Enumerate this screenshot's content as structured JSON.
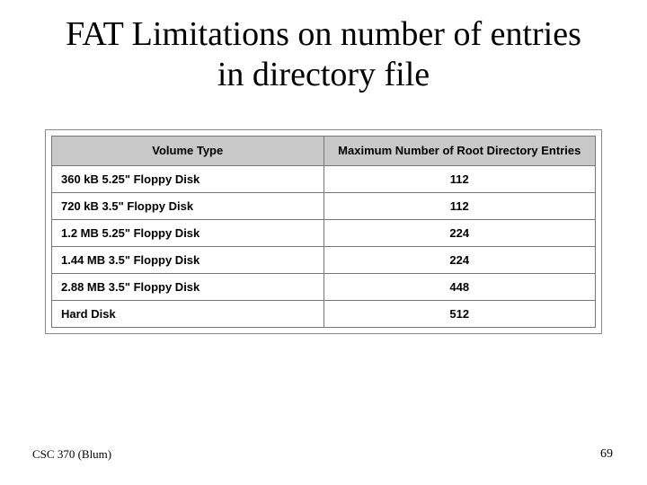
{
  "title": "FAT Limitations on number of entries in directory file",
  "chart_data": {
    "type": "table",
    "columns": [
      "Volume Type",
      "Maximum Number of Root Directory Entries"
    ],
    "rows": [
      {
        "volume": "360 kB 5.25\" Floppy Disk",
        "entries": "112"
      },
      {
        "volume": "720 kB 3.5\" Floppy Disk",
        "entries": "112"
      },
      {
        "volume": "1.2 MB 5.25\" Floppy Disk",
        "entries": "224"
      },
      {
        "volume": "1.44 MB 3.5\" Floppy Disk",
        "entries": "224"
      },
      {
        "volume": "2.88 MB 3.5\" Floppy Disk",
        "entries": "448"
      },
      {
        "volume": "Hard Disk",
        "entries": "512"
      }
    ]
  },
  "footer": {
    "course": "CSC 370 (Blum)",
    "page": "69"
  }
}
